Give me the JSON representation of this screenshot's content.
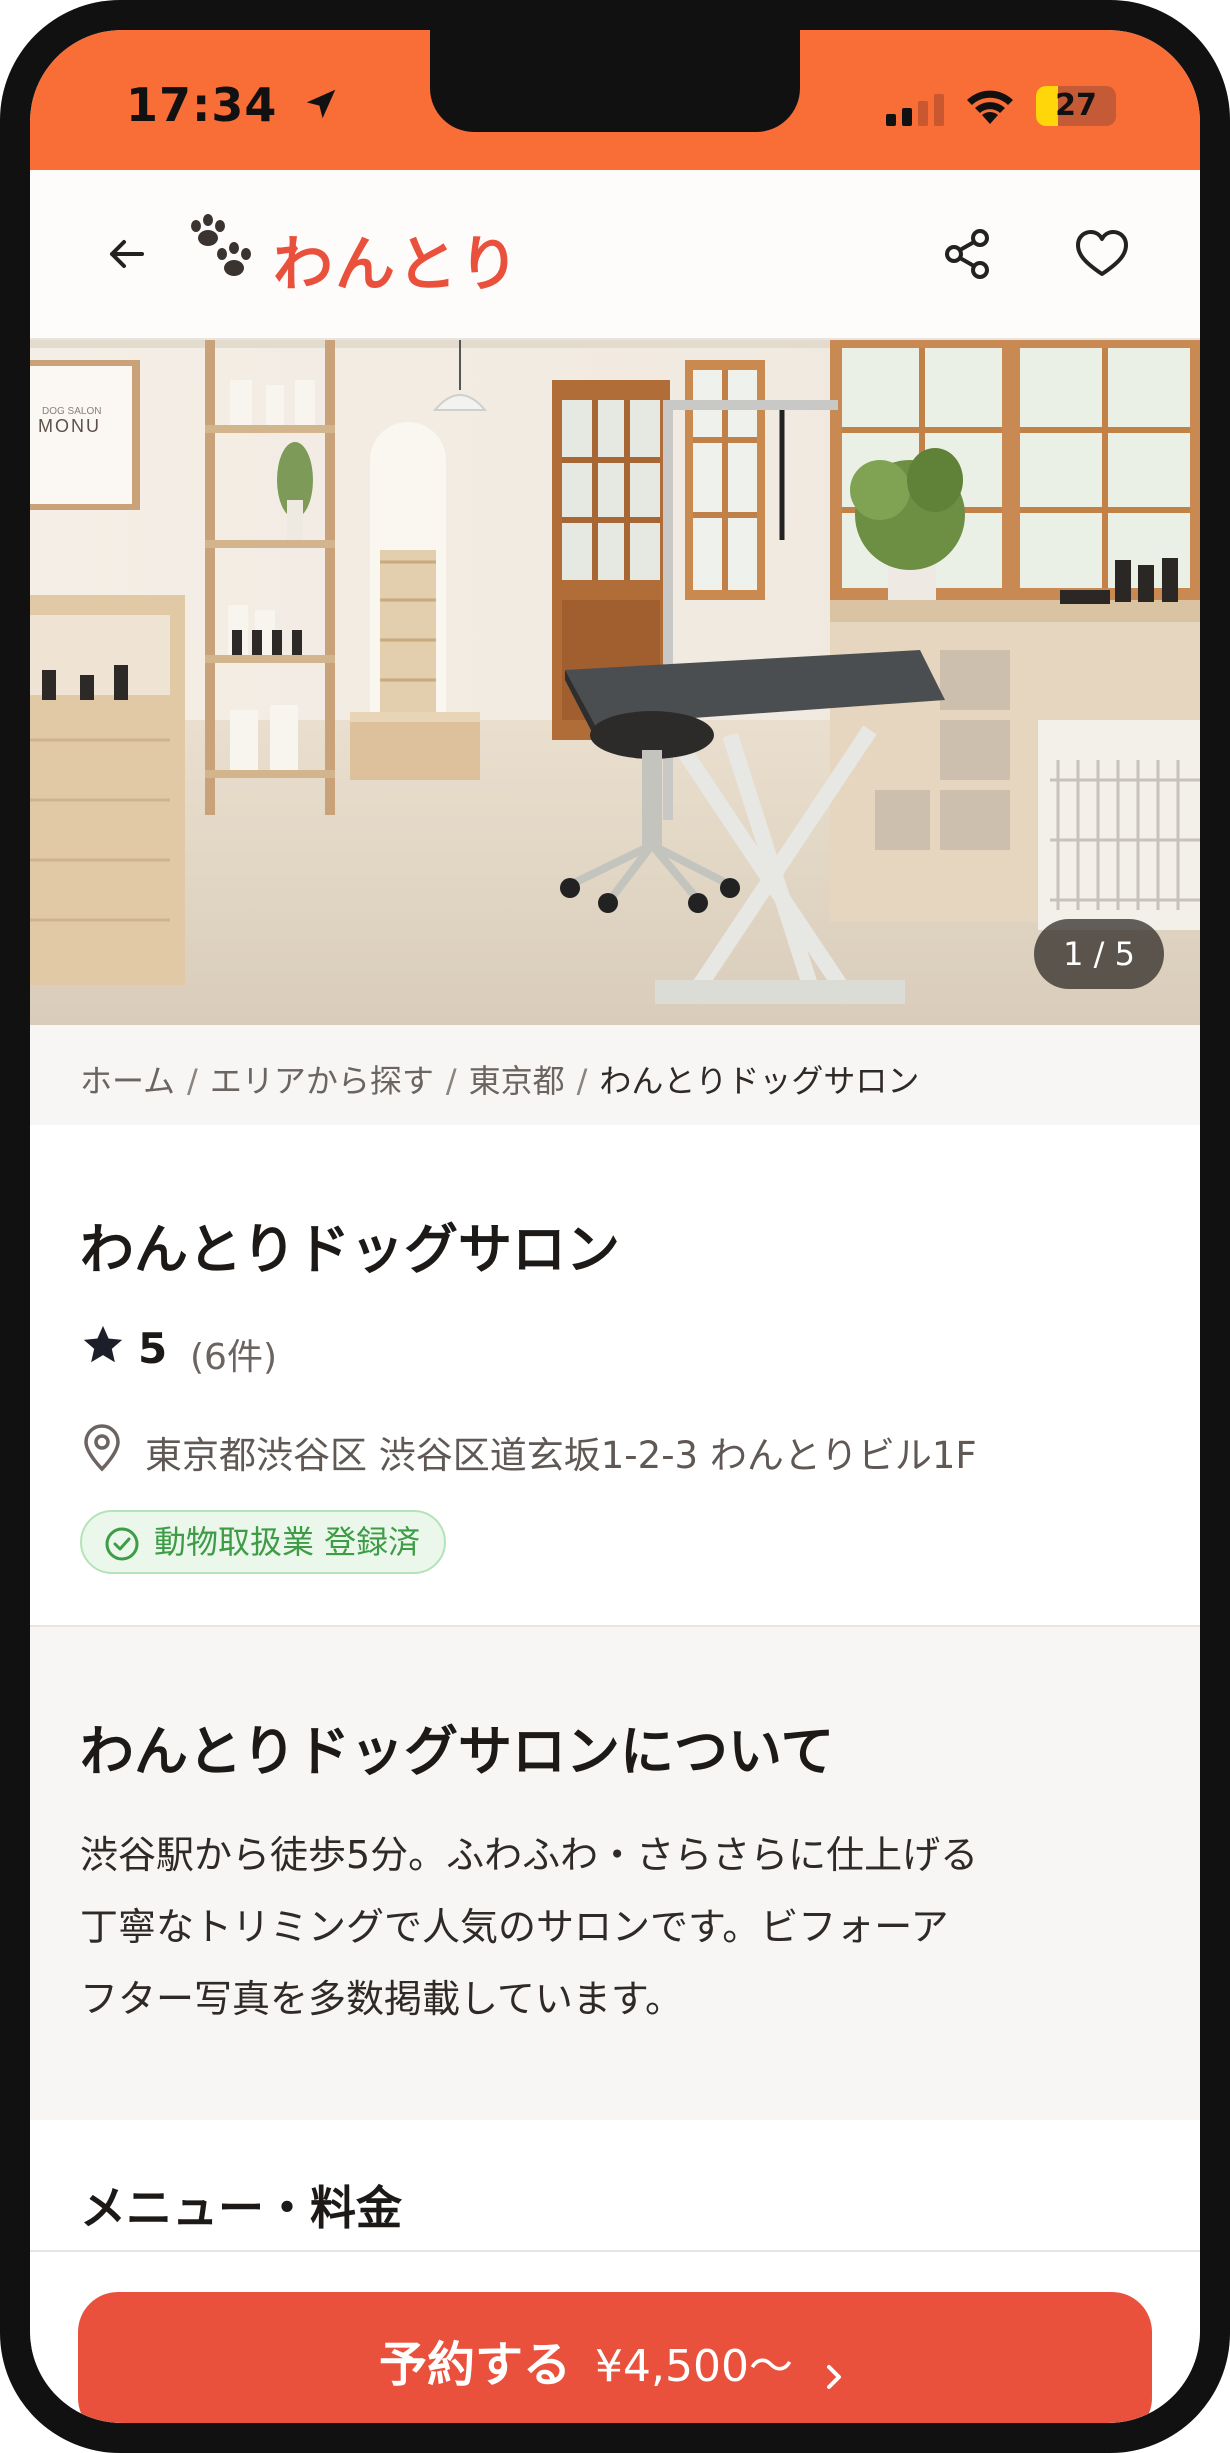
{
  "status_bar": {
    "time": "17:34",
    "battery": "27",
    "battery_level": 0.27
  },
  "header": {
    "logo_text": "わんとり"
  },
  "gallery": {
    "counter": "1 / 5",
    "sign_small": "DOG SALON",
    "sign_large": "MONU"
  },
  "breadcrumb": {
    "items": [
      "ホーム",
      "エリアから探す",
      "東京都"
    ],
    "current": "わんとりドッグサロン"
  },
  "salon": {
    "name": "わんとりドッグサロン",
    "rating": "5",
    "review_count": "(6件)",
    "address": "東京都渋谷区 渋谷区道玄坂1-2-3 わんとりビル1F",
    "badge": "動物取扱業 登録済"
  },
  "about": {
    "title": "わんとりドッグサロンについて",
    "lines": [
      "渋谷駅から徒歩5分。ふわふわ・さらさらに仕上げる",
      "丁寧なトリミングで人気のサロンです。ビフォーア",
      "フター写真を多数掲載しています。"
    ]
  },
  "menu": {
    "title": "メニュー・料金"
  },
  "cta": {
    "label": "予約する",
    "price": "¥4,500〜"
  },
  "colors": {
    "brand": "#e9513c",
    "status_bar": "#f96d37",
    "badge_green": "#3e9b46"
  }
}
